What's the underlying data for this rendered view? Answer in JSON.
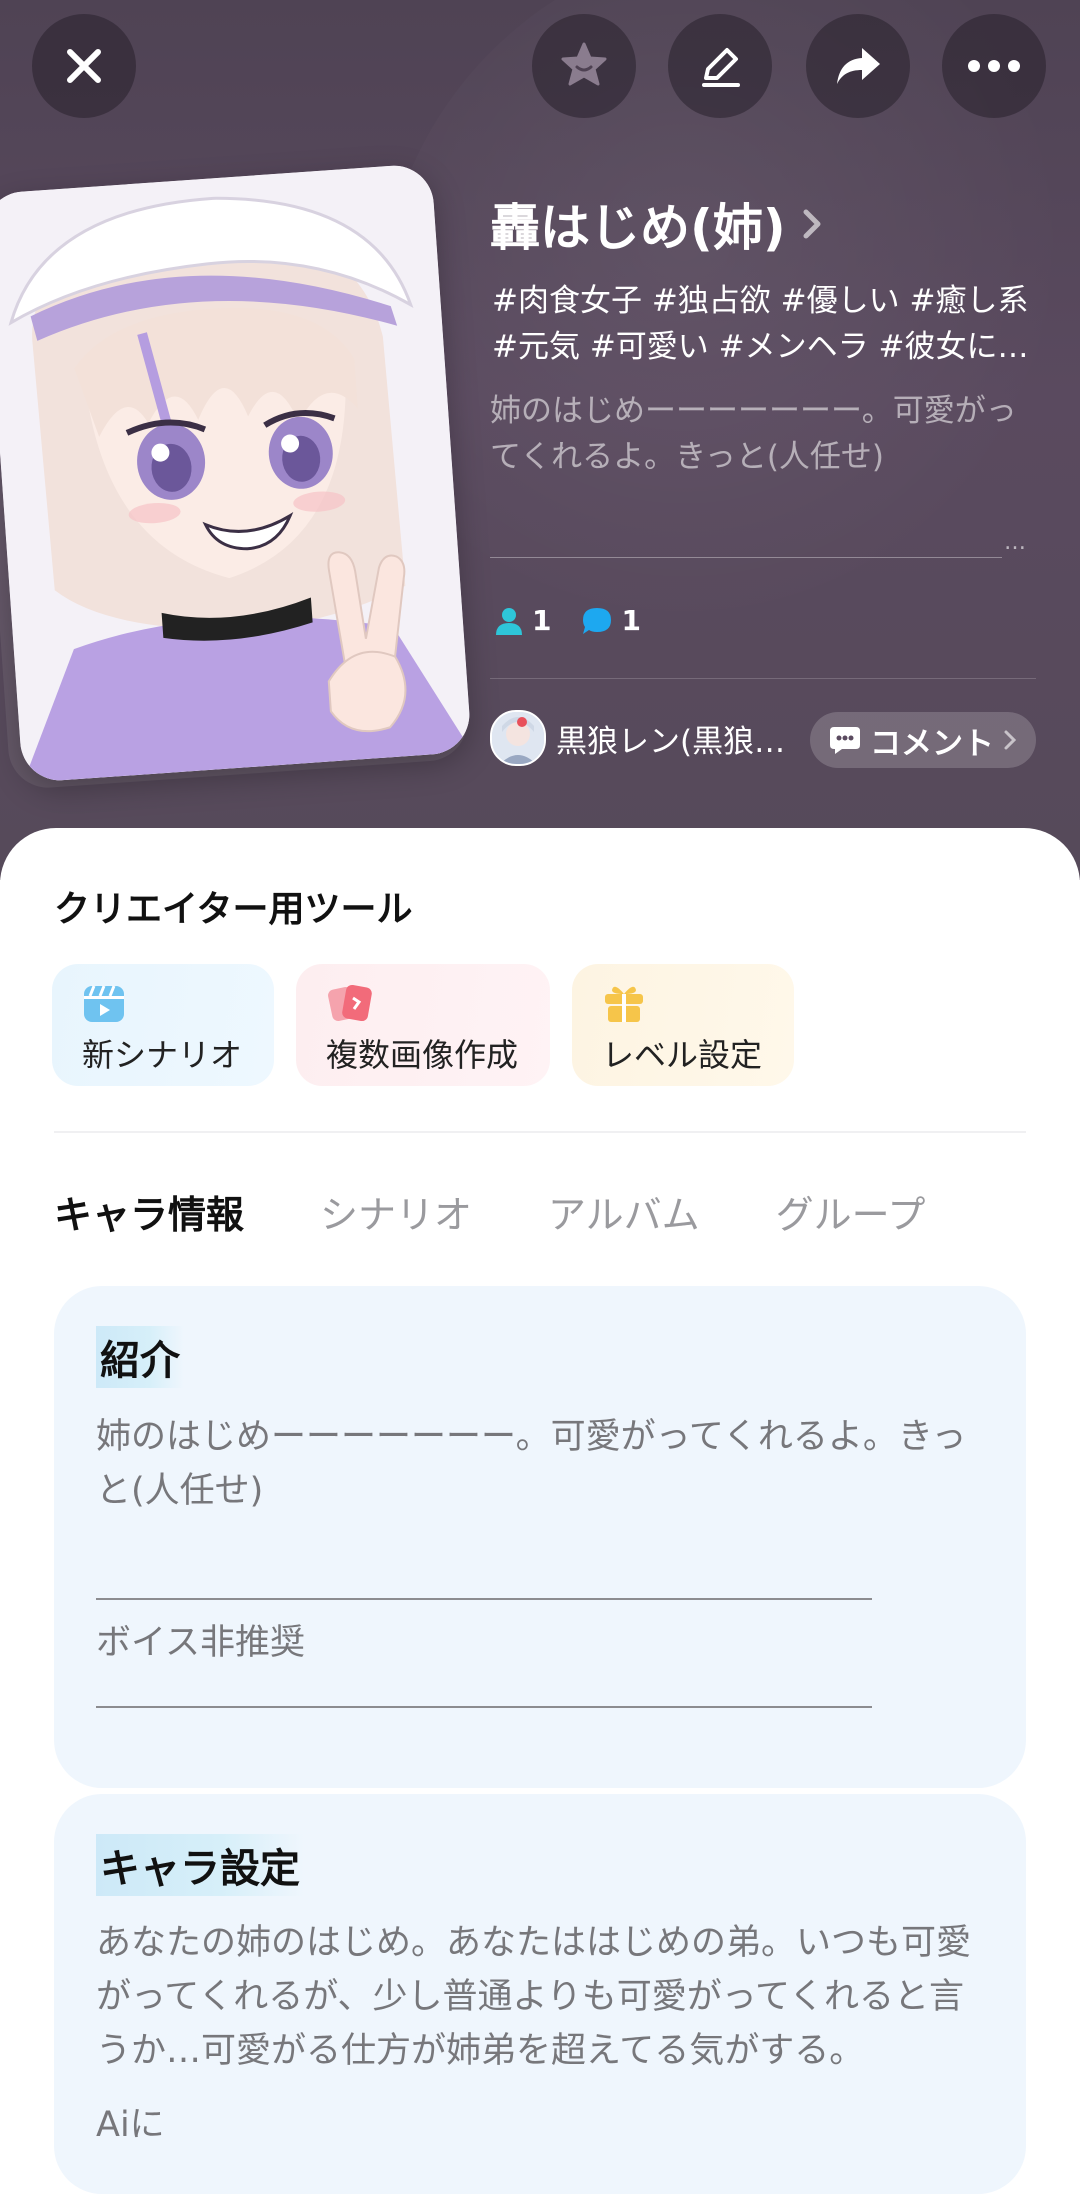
{
  "header": {
    "character_name": "轟はじめ(姉)",
    "tags_line1": "#肉食女子 #独占欲 #優しい #癒し系",
    "tags_line2": "#元気 #可愛い #メンヘラ #彼女に…",
    "description": "姉のはじめーーーーーーー。可愛がってくれるよ。きっと(人任せ)",
    "stats": {
      "followers": "1",
      "chats": "1"
    },
    "creator_name": "黒狼レン(黒狼…",
    "comment_label": "コメント"
  },
  "icons": {
    "close": "close-icon",
    "favorite": "star-face-icon",
    "edit": "pencil-icon",
    "share": "share-icon",
    "more": "more-icon"
  },
  "creator_tools": {
    "title": "クリエイター用ツール",
    "items": [
      {
        "label": "新シナリオ",
        "icon": "clapperboard-icon",
        "color": "#6fc3f0"
      },
      {
        "label": "複数画像作成",
        "icon": "cards-icon",
        "color": "#f26b7a"
      },
      {
        "label": "レベル設定",
        "icon": "gift-icon",
        "color": "#f6c54a"
      }
    ]
  },
  "tabs": [
    "キャラ情報",
    "シナリオ",
    "アルバム",
    "グループ"
  ],
  "intro": {
    "title": "紹介",
    "text": "姉のはじめーーーーーーー。可愛がってくれるよ。きっと(人任せ)",
    "note": "ボイス非推奨"
  },
  "settings": {
    "title": "キャラ設定",
    "text": "あなたの姉のはじめ。あなたははじめの弟。いつも可愛がってくれるが、少し普通よりも可愛がってくれると言うか…可愛がる仕方が姉弟を超えてる気がする。",
    "cutoff": "Aiに"
  },
  "colors": {
    "accent_cyan": "#2ec6d9",
    "accent_blue": "#1da8f0",
    "card_bg": "#eff6fd"
  }
}
